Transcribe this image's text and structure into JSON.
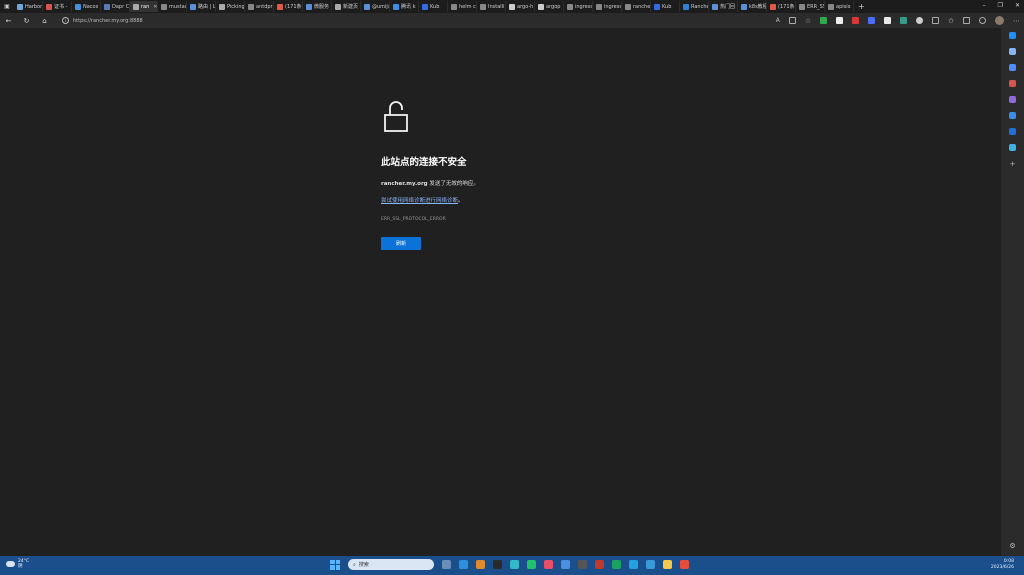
{
  "tabs": [
    {
      "label": "",
      "icon": "tab-actions-icon",
      "active": false
    },
    {
      "label": "Harbor",
      "icon": "harbor-icon",
      "active": false
    },
    {
      "label": "证书 -",
      "icon": "acrobat-icon",
      "active": false
    },
    {
      "label": "Nacos",
      "icon": "nacos-icon",
      "active": false
    },
    {
      "label": "Dapr C",
      "icon": "dapr-icon",
      "active": false
    },
    {
      "label": "ran",
      "icon": "page-icon",
      "active": true
    },
    {
      "label": "mustac",
      "icon": "page-icon",
      "active": false
    },
    {
      "label": "路由 | L",
      "icon": "globe-icon",
      "active": false
    },
    {
      "label": "Picking",
      "icon": "picking-icon",
      "active": false
    },
    {
      "label": "antdpr",
      "icon": "page-icon",
      "active": false
    },
    {
      "label": "(171条",
      "icon": "csdn-icon",
      "active": false
    },
    {
      "label": "微服务",
      "icon": "globe-icon",
      "active": false
    },
    {
      "label": "新建页",
      "icon": "newpage-icon",
      "active": false
    },
    {
      "label": "@umijs",
      "icon": "globe-icon",
      "active": false
    },
    {
      "label": "腾讯 k",
      "icon": "tencent-icon",
      "active": false
    },
    {
      "label": "Kub",
      "icon": "kubernetes-icon",
      "active": false
    },
    {
      "label": "helm c",
      "icon": "page-icon",
      "active": false
    },
    {
      "label": "Installi",
      "icon": "page-icon",
      "active": false
    },
    {
      "label": "argo-h",
      "icon": "github-icon",
      "active": false
    },
    {
      "label": "argop",
      "icon": "github-icon",
      "active": false
    },
    {
      "label": "ingress",
      "icon": "page-icon",
      "active": false
    },
    {
      "label": "ingress",
      "icon": "page-icon",
      "active": false
    },
    {
      "label": "rancher",
      "icon": "page-icon",
      "active": false
    },
    {
      "label": "Kub",
      "icon": "kubernetes-icon",
      "active": false
    },
    {
      "label": "Rancher",
      "icon": "rancher-icon",
      "active": false
    },
    {
      "label": "热门回",
      "icon": "globe-icon",
      "active": false
    },
    {
      "label": "k8s教程",
      "icon": "globe-icon",
      "active": false
    },
    {
      "label": "(171条",
      "icon": "csdn-icon",
      "active": false
    },
    {
      "label": "ERR_SS",
      "icon": "page-icon",
      "active": false
    },
    {
      "label": "apisix",
      "icon": "page-icon",
      "active": false
    }
  ],
  "window_controls": {
    "minimize": "–",
    "maximize": "❐",
    "close": "✕"
  },
  "address": {
    "url": "https://rancher.my.org:8888"
  },
  "error_page": {
    "title": "此站点的连接不安全",
    "host": "rancher.my.org",
    "message_suffix": " 发送了无效的响应。",
    "diagnostic_link": "尝试使用网络诊断进行网络诊断",
    "link_suffix": "。",
    "error_code": "ERR_SSL_PROTOCOL_ERROR",
    "reload_button": "刷新"
  },
  "sidebar": {
    "icons": [
      {
        "name": "copilot-icon",
        "color": "#1e90ff"
      },
      {
        "name": "search-icon",
        "color": "#8ab4f8"
      },
      {
        "name": "tag-icon",
        "color": "#4f8cff"
      },
      {
        "name": "briefcase-icon",
        "color": "#d9534f"
      },
      {
        "name": "games-icon",
        "color": "#8e6bd8"
      },
      {
        "name": "m365-icon",
        "color": "#3a8ee6"
      },
      {
        "name": "outlook-icon",
        "color": "#1e6fd9"
      },
      {
        "name": "send-icon",
        "color": "#3db3e3"
      }
    ]
  },
  "taskbar": {
    "weather_temp": "24°C",
    "weather_desc": "阴",
    "search_placeholder": "搜索",
    "time": "0:08",
    "date": "2023/6/26",
    "apps": [
      {
        "name": "task-view-icon",
        "color": "#6b8fb8"
      },
      {
        "name": "vscode-icon",
        "color": "#2f8fdf"
      },
      {
        "name": "store-icon",
        "color": "#e08a2e"
      },
      {
        "name": "obs-icon",
        "color": "#2a2a2a"
      },
      {
        "name": "edge-icon",
        "color": "#30b9c6"
      },
      {
        "name": "pycharm-icon",
        "color": "#21c16b"
      },
      {
        "name": "idea-icon",
        "color": "#e94f6b"
      },
      {
        "name": "triangle-app-icon",
        "color": "#4a90e2"
      },
      {
        "name": "game-icon",
        "color": "#555"
      },
      {
        "name": "remote-icon",
        "color": "#c0392b"
      },
      {
        "name": "h-app-icon",
        "color": "#1aa260"
      },
      {
        "name": "vscode-insiders-icon",
        "color": "#24a1e0"
      },
      {
        "name": "todo-icon",
        "color": "#3a9ad9"
      },
      {
        "name": "folder-icon",
        "color": "#f2c94c"
      },
      {
        "name": "xmind-icon",
        "color": "#e74c3c"
      }
    ]
  }
}
